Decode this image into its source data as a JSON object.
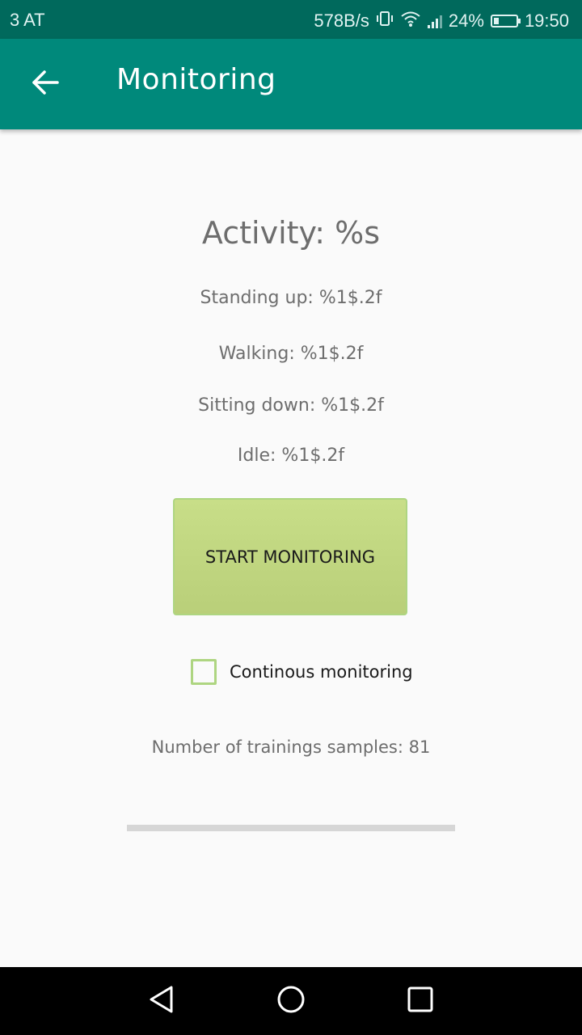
{
  "status_bar": {
    "carrier": "3 AT",
    "speed": "578B/s",
    "battery_percent": "24%",
    "battery_level": 0.24,
    "time": "19:50"
  },
  "app_bar": {
    "title": "Monitoring",
    "back_icon": "arrow-back-icon"
  },
  "main": {
    "activity_title": "Activity: %s",
    "stats": {
      "standing": "Standing up: %1$.2f",
      "walking": "Walking: %1$.2f",
      "sitting": "Sitting down: %1$.2f",
      "idle": "Idle: %1$.2f"
    },
    "start_button_label": "START MONITORING",
    "checkbox": {
      "label": "Continous monitoring",
      "checked": false
    },
    "samples_text": "Number of trainings samples: 81",
    "progress": 0
  },
  "nav_bar": {
    "icons": [
      "back-triangle-icon",
      "home-circle-icon",
      "recent-square-icon"
    ]
  },
  "colors": {
    "status_bar": "#00695c",
    "app_bar": "#00897b",
    "button_green": "#c5db84",
    "checkbox_border": "#aed581"
  }
}
